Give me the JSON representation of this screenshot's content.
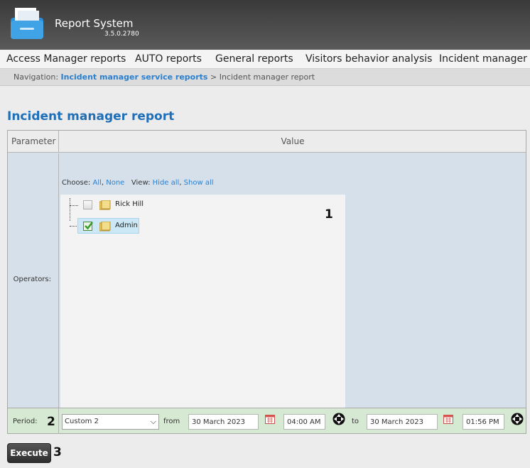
{
  "header": {
    "title": "Report System",
    "version": "3.5.0.2780",
    "icon": "folder-icon"
  },
  "menu": [
    "Access Manager reports",
    "AUTO reports",
    "General reports",
    "Visitors behavior analysis",
    "Incident manager"
  ],
  "breadcrumb": {
    "prefix": "Navigation:",
    "link": "Incident manager service reports",
    "separator": ">",
    "current": "Incident manager report"
  },
  "page": {
    "title": "Incident manager report"
  },
  "table": {
    "col_parameter": "Parameter",
    "col_value": "Value",
    "operators_label": "Operators:",
    "choose_label": "Choose:",
    "choose_all": "All",
    "choose_none": "None",
    "view_label": "View:",
    "view_hide_all": "Hide all",
    "view_show_all": "Show all",
    "operators": [
      {
        "name": "Rick Hill",
        "checked": false
      },
      {
        "name": "Admin",
        "checked": true,
        "selected": true
      }
    ],
    "period_label": "Period:",
    "period_value": "Custom 2",
    "from_label": "from",
    "from_date": "30 March 2023",
    "from_time": "04:00 AM",
    "to_label": "to",
    "to_date": "30 March 2023",
    "to_time": "01:56 PM"
  },
  "callouts": {
    "c1": "1",
    "c2": "2",
    "c3": "3"
  },
  "execute_label": "Execute",
  "colors": {
    "accent": "#1f6fb8",
    "link": "#2a7fd0",
    "header_bg": "#4a4a4a"
  }
}
